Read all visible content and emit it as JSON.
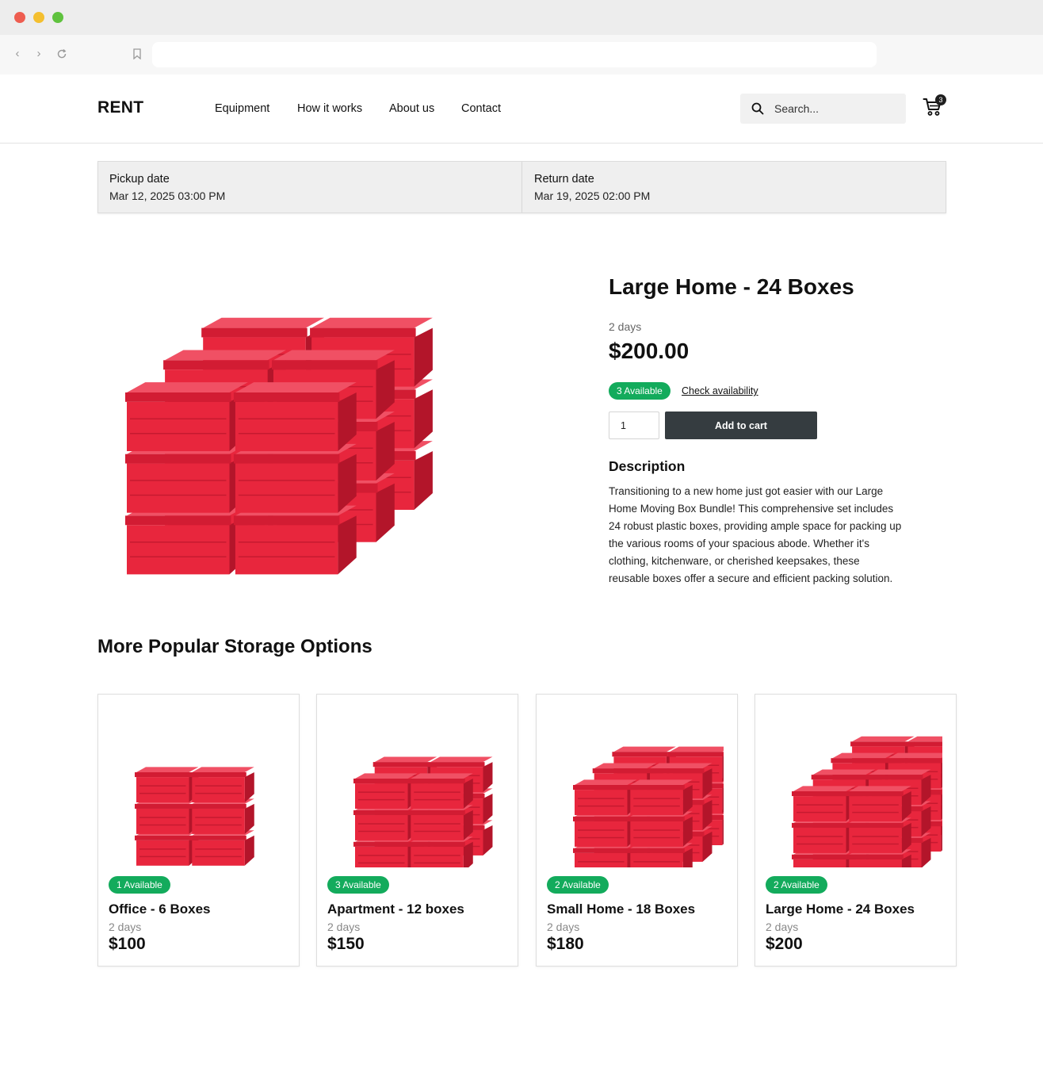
{
  "site": {
    "logo": "RENT",
    "nav": [
      "Equipment",
      "How it works",
      "About us",
      "Contact"
    ],
    "search_placeholder": "Search...",
    "cart_count": "3"
  },
  "dates": {
    "pickup_label": "Pickup date",
    "pickup_value": "Mar 12, 2025 03:00 PM",
    "return_label": "Return date",
    "return_value": "Mar 19, 2025 02:00 PM"
  },
  "product": {
    "title": "Large Home - 24 Boxes",
    "duration": "2 days",
    "price": "$200.00",
    "availability": "3 Available",
    "check_link": "Check availability",
    "quantity": "1",
    "add_to_cart": "Add to cart",
    "description_heading": "Description",
    "description": "Transitioning to a new home just got easier with our Large Home Moving Box Bundle! This comprehensive set includes 24 robust plastic boxes, providing ample space for packing up the various rooms of your spacious abode. Whether it's clothing, kitchenware, or cherished keepsakes, these reusable boxes offer a secure and efficient packing solution."
  },
  "more": {
    "title": "More Popular Storage Options",
    "cards": [
      {
        "availability": "1 Available",
        "title": "Office - 6 Boxes",
        "duration": "2 days",
        "price": "$100"
      },
      {
        "availability": "3 Available",
        "title": "Apartment - 12 boxes",
        "duration": "2 days",
        "price": "$150"
      },
      {
        "availability": "2 Available",
        "title": "Small Home - 18 Boxes",
        "duration": "2 days",
        "price": "$180"
      },
      {
        "availability": "2 Available",
        "title": "Large Home - 24 Boxes",
        "duration": "2 days",
        "price": "$200"
      }
    ]
  },
  "colors": {
    "accent_green": "#13ab5c",
    "button_dark": "#353c40",
    "box_red": "#e8263d"
  },
  "icons": [
    "back-arrow-icon",
    "forward-arrow-icon",
    "reload-icon",
    "bookmark-icon",
    "search-icon",
    "cart-icon"
  ]
}
